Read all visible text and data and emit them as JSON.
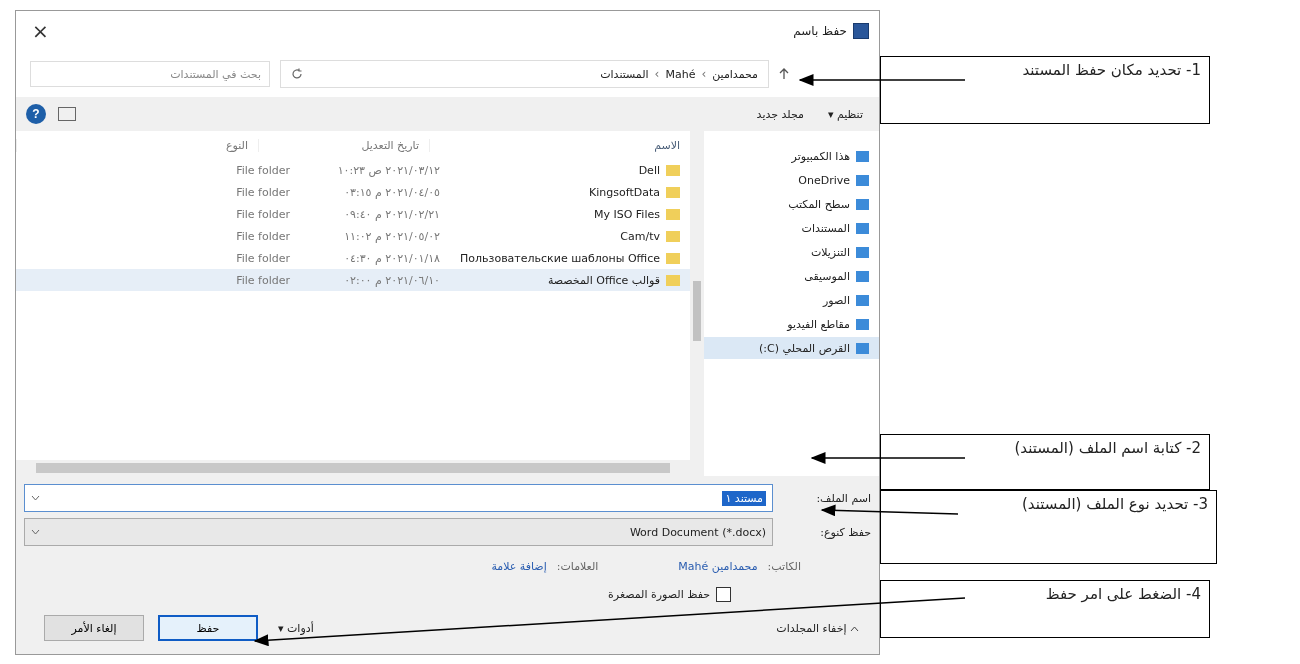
{
  "window": {
    "title": "حفظ باسم",
    "close": "×"
  },
  "address_bar": {
    "path": [
      "محمدامين",
      "Mahé",
      "المستندات"
    ],
    "separator": "›",
    "search_placeholder": "بحث في المستندات"
  },
  "toolbar": {
    "organize": "تنظيم ▾",
    "new_folder": "مجلد جديد",
    "help": "?"
  },
  "sidebar": {
    "items": [
      {
        "label": "هذا الكمبيوتر",
        "selected": false
      },
      {
        "label": "OneDrive",
        "selected": false
      },
      {
        "label": "سطح المكتب",
        "selected": false
      },
      {
        "label": "المستندات",
        "selected": false
      },
      {
        "label": "التنزيلات",
        "selected": false
      },
      {
        "label": "الموسيقى",
        "selected": false
      },
      {
        "label": "الصور",
        "selected": false
      },
      {
        "label": "مقاطع الفيديو",
        "selected": false
      },
      {
        "label": "القرص المحلي (C:)",
        "selected": true
      }
    ]
  },
  "table": {
    "columns": [
      "الاسم",
      "تاريخ التعديل",
      "النوع"
    ],
    "rows": [
      {
        "name": "Dell",
        "date": "٢٠٢١/٠٣/١٢ ص ١٠:٢٣",
        "type": "File folder",
        "selected": false
      },
      {
        "name": "KingsoftData",
        "date": "٢٠٢١/٠٤/٠٥ م ٠٣:١٥",
        "type": "File folder",
        "selected": false
      },
      {
        "name": "My ISO Files",
        "date": "٢٠٢١/٠٢/٢١ م ٠٩:٤٠",
        "type": "File folder",
        "selected": false
      },
      {
        "name": "Cam/tv",
        "date": "٢٠٢١/٠٥/٠٢ م ١١:٠٢",
        "type": "File folder",
        "selected": false
      },
      {
        "name": "Пользовательские шаблоны Office",
        "date": "٢٠٢١/٠١/١٨ م ٠٤:٣٠",
        "type": "File folder",
        "selected": false
      },
      {
        "name": "قوالب Office المخصصة",
        "date": "٢٠٢١/٠٦/١٠ م ٠٢:٠٠",
        "type": "File folder",
        "selected": true
      }
    ]
  },
  "form": {
    "file_name_label": "اسم الملف:",
    "file_name": "مستند ١",
    "type_label": "حفظ كنوع:",
    "type_value": "Word Document (*.docx)",
    "author_label": "الكاتب:",
    "author": "محمدامين Mahé",
    "tags_label": "العلامات:",
    "tags_link": "إضافة علامة",
    "thumbnail": {
      "label": "حفظ الصورة المصغرة",
      "checked": false
    }
  },
  "footer": {
    "hide_folders": "إخفاء المجلدات",
    "tools": "أدوات ▾",
    "save": "حفظ",
    "cancel": "إلغاء الأمر"
  },
  "annotations": [
    "1- تحديد مكان حفظ المستند",
    "2- كتابة اسم الملف (المستند)",
    "3- تحديد نوع الملف (المستند)",
    "4- الضغط على امر حفظ"
  ]
}
